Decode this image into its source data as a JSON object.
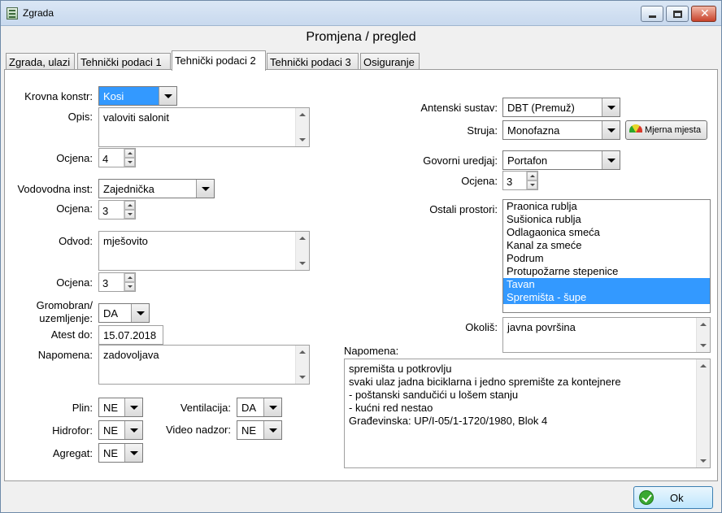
{
  "window": {
    "title": "Zgrada",
    "heading": "Promjena / pregled"
  },
  "tabs": [
    {
      "label": "Zgrada, ulazi"
    },
    {
      "label": "Tehnički podaci 1"
    },
    {
      "label": "Tehnički podaci 2",
      "active": true
    },
    {
      "label": "Tehnički podaci 3"
    },
    {
      "label": "Osiguranje"
    }
  ],
  "left": {
    "krovna_konstr": {
      "label": "Krovna konstr:",
      "value": "Kosi"
    },
    "opis": {
      "label": "Opis:",
      "value": "valoviti salonit"
    },
    "ocjena1": {
      "label": "Ocjena:",
      "value": "4"
    },
    "vodovodna": {
      "label": "Vodovodna inst:",
      "value": "Zajednička"
    },
    "ocjena2": {
      "label": "Ocjena:",
      "value": "3"
    },
    "odvod": {
      "label": "Odvod:",
      "value": "mješovito"
    },
    "ocjena3": {
      "label": "Ocjena:",
      "value": "3"
    },
    "gromobran": {
      "label_line1": "Gromobran/",
      "label_line2": "uzemljenje:",
      "value": "DA"
    },
    "atest_do": {
      "label": "Atest do:",
      "value": "15.07.2018"
    },
    "napomena": {
      "label": "Napomena:",
      "value": "zadovoljava"
    },
    "plin": {
      "label": "Plin:",
      "value": "NE"
    },
    "hidrofor": {
      "label": "Hidrofor:",
      "value": "NE"
    },
    "agregat": {
      "label": "Agregat:",
      "value": "NE"
    },
    "ventilacija": {
      "label": "Ventilacija:",
      "value": "DA"
    },
    "video_nadzor": {
      "label": "Video nadzor:",
      "value": "NE"
    }
  },
  "right": {
    "antenski_sustav": {
      "label": "Antenski sustav:",
      "value": "DBT (Premuž)"
    },
    "struja": {
      "label": "Struja:",
      "value": "Monofazna"
    },
    "mjerna_mjesta_button": "Mjerna mjesta",
    "govorni_uredjaj": {
      "label": "Govorni uredjaj:",
      "value": "Portafon"
    },
    "ocjena": {
      "label": "Ocjena:",
      "value": "3"
    },
    "ostali_prostori": {
      "label": "Ostali prostori:",
      "items": [
        {
          "text": "Praonica rublja",
          "selected": false
        },
        {
          "text": "Sušionica rublja",
          "selected": false
        },
        {
          "text": "Odlagaonica smeća",
          "selected": false
        },
        {
          "text": "Kanal za smeće",
          "selected": false
        },
        {
          "text": "Podrum",
          "selected": false
        },
        {
          "text": "Protupožarne stepenice",
          "selected": false
        },
        {
          "text": "Tavan",
          "selected": true
        },
        {
          "text": "Spremišta - šupe",
          "selected": true
        }
      ]
    },
    "okolis": {
      "label": "Okoliš:",
      "value": "javna površina"
    },
    "napomena": {
      "label": "Napomena:",
      "value": "spremišta u potkrovlju\nsvaki ulaz jadna biciklarna i jedno spremište za kontejnere\n- poštanski sandučići u lošem stanju\n- kućni red nestao\nGrađevinska: UP/I-05/1-1720/1980, Blok 4"
    }
  },
  "footer": {
    "ok_label": "Ok"
  },
  "colors": {
    "selection": "#3399ff",
    "titlebar": "#c8d9ee",
    "ok_icon": "#3aa832"
  },
  "icons": [
    "app-icon",
    "minimize-icon",
    "maximize-icon",
    "close-icon",
    "gauge-icon",
    "checkmark-icon"
  ]
}
